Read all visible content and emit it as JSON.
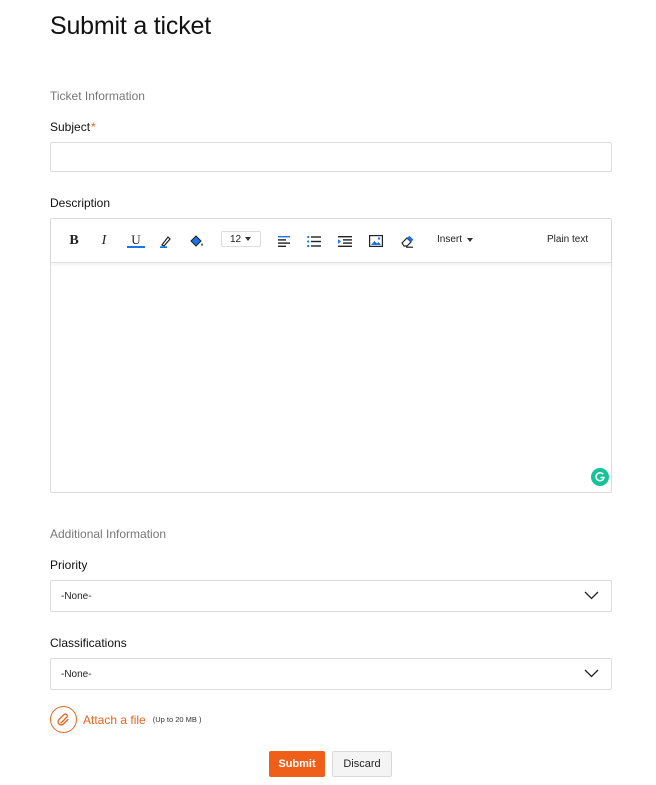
{
  "page": {
    "title": "Submit a ticket"
  },
  "ticket_info": {
    "section_title": "Ticket Information",
    "subject": {
      "label": "Subject",
      "required_mark": "*",
      "value": "",
      "placeholder": ""
    },
    "description": {
      "label": "Description",
      "toolbar": {
        "bold": "B",
        "italic": "I",
        "underline": "U",
        "font_size": "12",
        "insert": "Insert",
        "plain_text": "Plain text",
        "icons": [
          "bold-icon",
          "italic-icon",
          "underline-icon",
          "text-color-icon",
          "background-color-icon",
          "align-left-icon",
          "bullet-list-icon",
          "indent-icon",
          "image-icon",
          "eraser-icon",
          "chevron-down-icon"
        ]
      },
      "value": ""
    }
  },
  "additional_info": {
    "section_title": "Additional Information",
    "priority": {
      "label": "Priority",
      "selected": "-None-"
    },
    "classifications": {
      "label": "Classifications",
      "selected": "-None-"
    }
  },
  "attachment": {
    "label": "Attach a file",
    "note": "(Up to 20 MB )"
  },
  "actions": {
    "submit": "Submit",
    "discard": "Discard"
  },
  "colors": {
    "accent": "#ef5f1a",
    "required": "#e8641e",
    "grammarly": "#15c39a",
    "toolbar_icon_blue": "#1a73e8"
  }
}
